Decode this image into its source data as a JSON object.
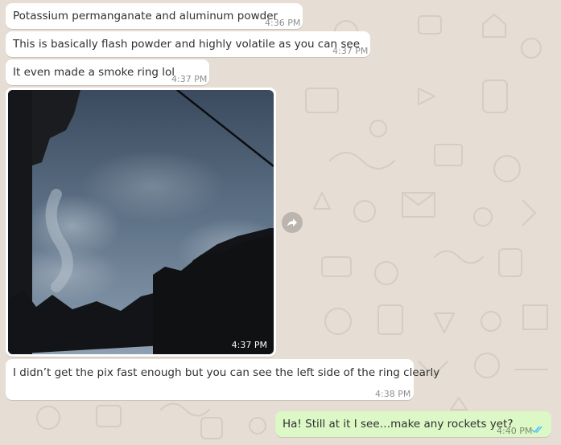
{
  "messages": [
    {
      "text": "Potassium permanganate and aluminum powder",
      "time": "4:36 PM"
    },
    {
      "text": "This is basically flash powder and highly volatile as you can see",
      "time": "4:37 PM"
    },
    {
      "text": "It even made a smoke ring lol",
      "time": "4:37 PM"
    },
    {
      "time": "4:37 PM"
    },
    {
      "text": "I didn’t get the pix fast enough but you can see the left side of the ring clearly",
      "time": "4:38 PM"
    },
    {
      "text": "Ha! Still at it I see…make any rockets yet?",
      "time": "4:40 PM"
    }
  ],
  "icons": {
    "forward": "forward-arrow-icon",
    "read_receipt": "double-check-icon"
  },
  "colors": {
    "background": "#e6ddd4",
    "incoming_bubble": "#ffffff",
    "outgoing_bubble": "#dcf8c6",
    "read_ticks": "#4fc3f7"
  }
}
